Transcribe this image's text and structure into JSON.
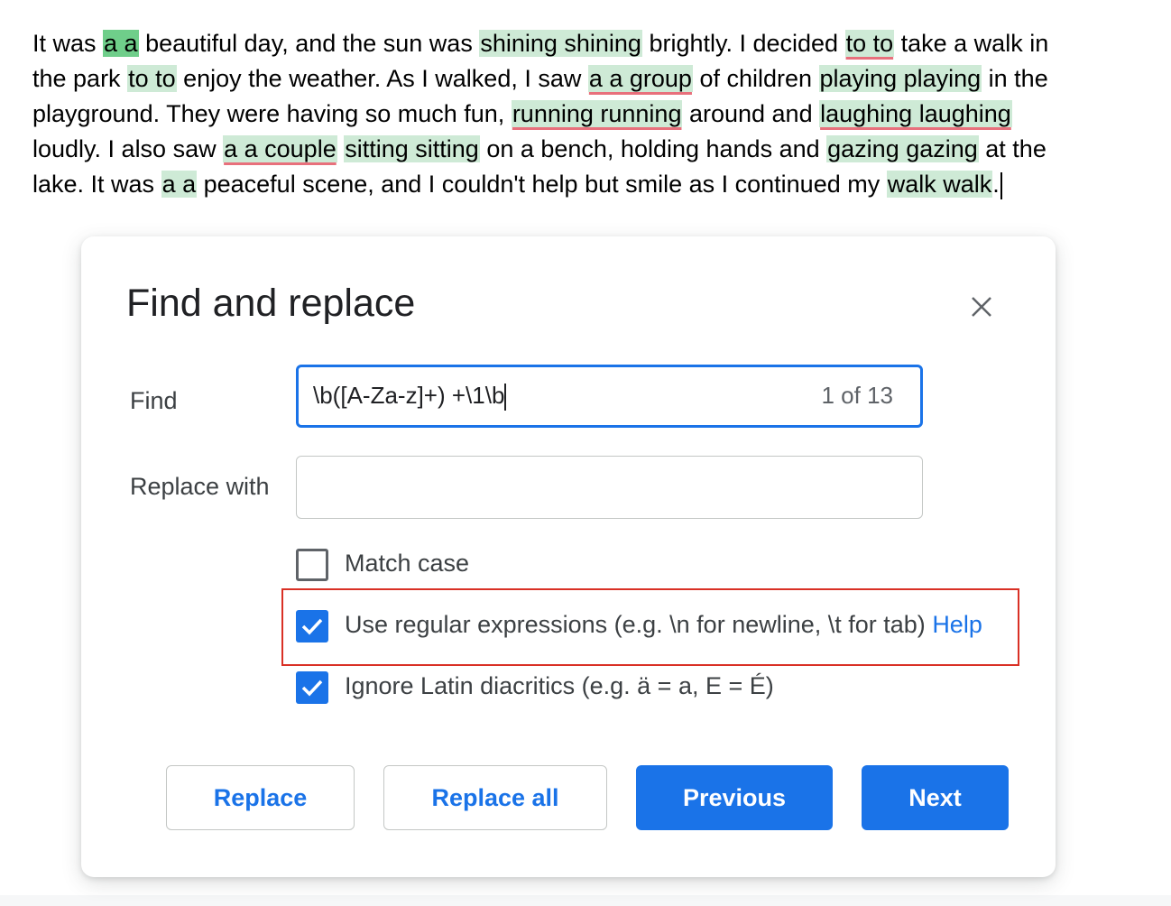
{
  "document": {
    "lines": [
      [
        {
          "t": "It was "
        },
        {
          "t": "a a",
          "hl": true,
          "cur": true
        },
        {
          "t": " beautiful day, and the sun was "
        },
        {
          "t": "shining shining",
          "hl": true
        },
        {
          "t": " brightly. I decided "
        },
        {
          "t": "to to",
          "hl": true,
          "sp": true
        },
        {
          "t": " take a walk in"
        }
      ],
      [
        {
          "t": "the park "
        },
        {
          "t": "to to",
          "hl": true
        },
        {
          "t": " enjoy the weather. As I walked, I saw "
        },
        {
          "t": "a a group",
          "hl": true,
          "sp": true
        },
        {
          "t": " of children "
        },
        {
          "t": "playing playing",
          "hl": true
        },
        {
          "t": " in the"
        }
      ],
      [
        {
          "t": "playground. They were having so much fun, "
        },
        {
          "t": "running running",
          "hl": true,
          "sp": true
        },
        {
          "t": " around and "
        },
        {
          "t": "laughing laughing",
          "hl": true,
          "sp": true
        }
      ],
      [
        {
          "t": "loudly. I also saw "
        },
        {
          "t": "a a couple",
          "hl": true,
          "sp": true
        },
        {
          "t": " "
        },
        {
          "t": "sitting sitting",
          "hl": true
        },
        {
          "t": " on a bench, holding hands and "
        },
        {
          "t": "gazing gazing",
          "hl": true
        },
        {
          "t": " at the"
        }
      ],
      [
        {
          "t": "lake. It was "
        },
        {
          "t": "a a",
          "hl": true
        },
        {
          "t": " peaceful scene, and I couldn't help but smile as I continued my "
        },
        {
          "t": "walk walk",
          "hl": true
        },
        {
          "t": "."
        }
      ]
    ]
  },
  "dialog": {
    "title": "Find and replace",
    "close_icon": "close-icon",
    "find_label": "Find",
    "find_value": "\\b([A-Za-z]+) +\\1\\b",
    "match_counter": "1 of 13",
    "replace_label": "Replace with",
    "replace_value": "",
    "options": {
      "match_case": {
        "label": "Match case",
        "checked": false
      },
      "use_regex": {
        "label": "Use regular expressions (e.g. \\n for newline, \\t for tab)",
        "help_link": "Help",
        "checked": true
      },
      "ignore_diacritics": {
        "label": "Ignore Latin diacritics (e.g. ä = a, E = É)",
        "checked": true
      }
    },
    "buttons": {
      "replace": "Replace",
      "replace_all": "Replace all",
      "previous": "Previous",
      "next": "Next"
    }
  },
  "colors": {
    "accent": "#1a73e8",
    "match_highlight": "#ceead6",
    "current_match_highlight": "#6fce8a",
    "spellcheck_underline": "#e8707c",
    "focus_outline": "#d93025"
  }
}
